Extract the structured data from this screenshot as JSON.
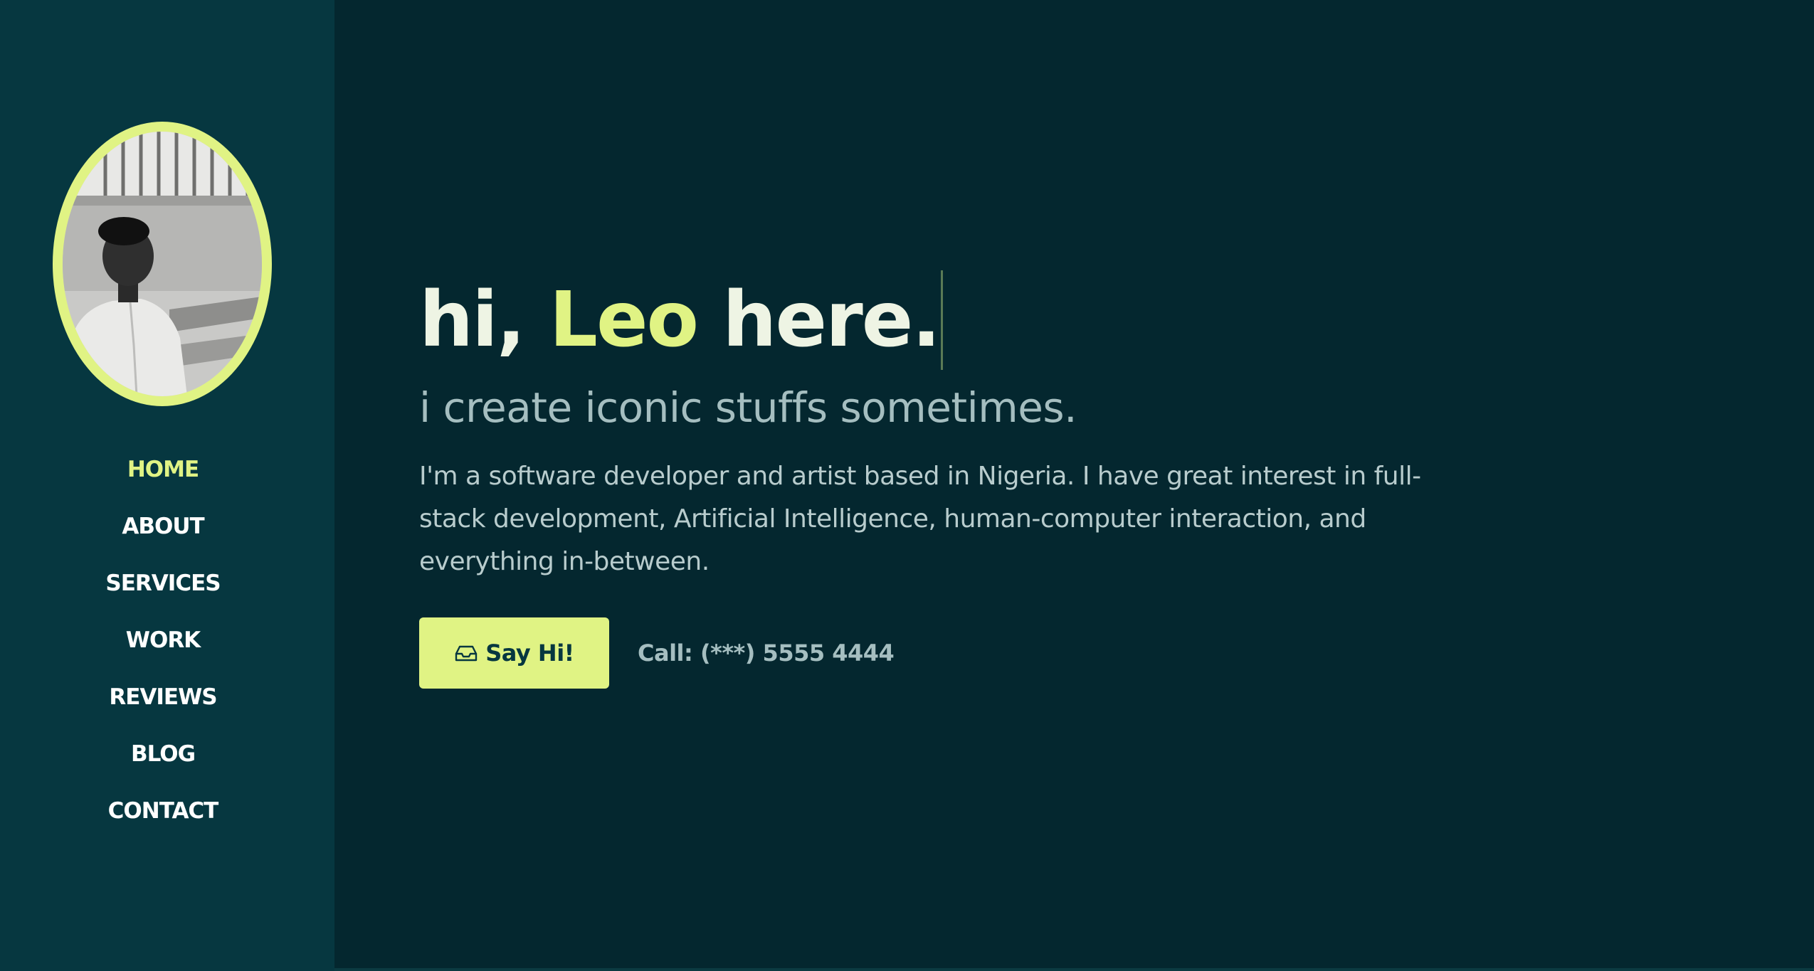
{
  "sidebar": {
    "avatar_alt": "Profile photo",
    "nav": [
      {
        "label": "HOME",
        "active": true
      },
      {
        "label": "ABOUT",
        "active": false
      },
      {
        "label": "SERVICES",
        "active": false
      },
      {
        "label": "WORK",
        "active": false
      },
      {
        "label": "REVIEWS",
        "active": false
      },
      {
        "label": "BLOG",
        "active": false
      },
      {
        "label": "CONTACT",
        "active": false
      }
    ]
  },
  "hero": {
    "greeting_prefix": "hi, ",
    "name": "Leo",
    "greeting_suffix": " here.",
    "tagline": "i create iconic stuffs sometimes.",
    "bio": "I'm a software developer and artist based in Nigeria. I have great interest in full-stack development, Artificial Intelligence, human-computer interaction, and everything in-between.",
    "cta_label": "Say Hi!",
    "cta_icon": "inbox-icon",
    "call_text": "Call: (***) 5555 4444"
  },
  "colors": {
    "background": "#04272f",
    "sidebar": "#063740",
    "accent": "#e0f384",
    "heading": "#eef4e4",
    "muted": "#a5bec0"
  }
}
